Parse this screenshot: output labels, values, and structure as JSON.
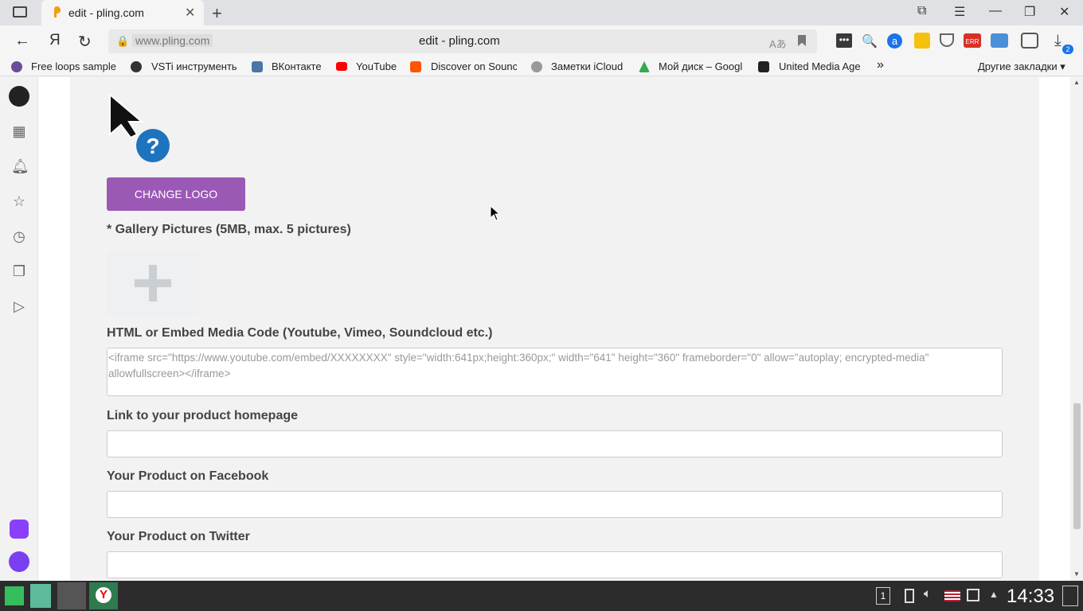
{
  "tab": {
    "title": "edit - pling.com",
    "close": "✕",
    "new": "+"
  },
  "window": {
    "minimize": "—",
    "restore": "❐",
    "close": "✕"
  },
  "address": {
    "host": "www.pling.com",
    "title": "edit - pling.com"
  },
  "bookmarks": [
    {
      "label": "Free loops sample",
      "color": "#6b4c9a"
    },
    {
      "label": "VSTi инструменты",
      "color": "#333333"
    },
    {
      "label": "ВКонтакте",
      "color": "#4a76a8"
    },
    {
      "label": "YouTube",
      "color": "#ff0000"
    },
    {
      "label": "Discover on Sounc",
      "color": "#ff5500"
    },
    {
      "label": "Заметки iCloud",
      "color": "#999999"
    },
    {
      "label": "Мой диск – Googl",
      "color": "#34a853"
    },
    {
      "label": "United Media Age",
      "color": "#222222"
    }
  ],
  "bookmarks_more": "»",
  "other_bookmarks": "Другие закладки ▾",
  "form": {
    "change_logo": "CHANGE LOGO",
    "gallery_label": "* Gallery Pictures (5MB, max. 5 pictures)",
    "embed_label": "HTML or Embed Media Code (Youtube, Vimeo, Soundcloud etc.)",
    "embed_placeholder": "<iframe src=\"https://www.youtube.com/embed/XXXXXXXX\" style=\"width:641px;height:360px;\" width=\"641\" height=\"360\" frameborder=\"0\" allow=\"autoplay; encrypted-media\" allowfullscreen></iframe>",
    "homepage_label": "Link to your product homepage",
    "facebook_label": "Your Product on Facebook",
    "twitter_label": "Your Product on Twitter"
  },
  "taskbar": {
    "clock": "14:33",
    "workspace": "1"
  },
  "colors": {
    "accent": "#9b59b6",
    "badge": "#1a73e8"
  }
}
